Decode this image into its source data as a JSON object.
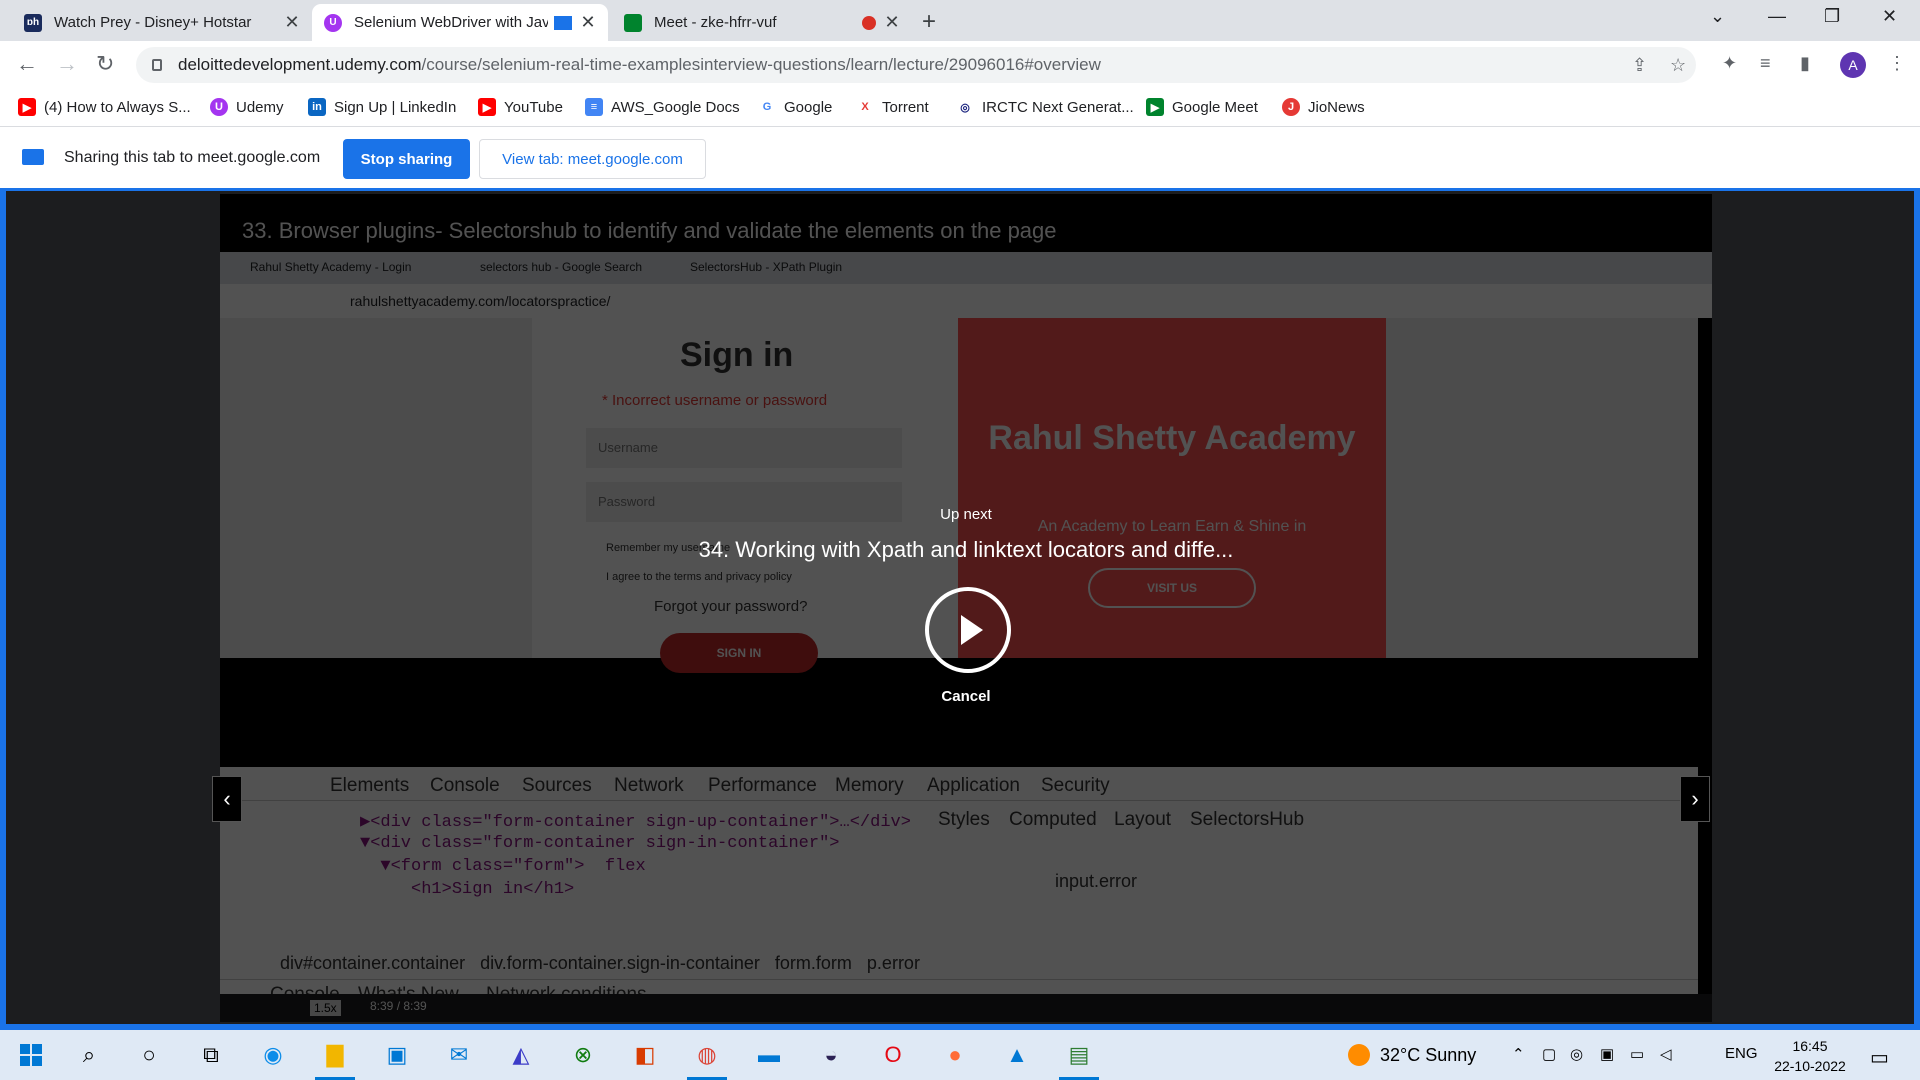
{
  "browser": {
    "tabs": [
      {
        "title": "Watch Prey - Disney+ Hotstar",
        "favicon": "hotstar-icon",
        "favicon_text": "ɒh",
        "color": "#1a2b5c"
      },
      {
        "title": "Selenium WebDriver with Jav",
        "favicon": "udemy-icon",
        "favicon_text": "U",
        "color": "#a435f0"
      },
      {
        "title": "Meet - zke-hfrr-vuf",
        "favicon": "google-meet-icon",
        "favicon_text": "",
        "color": "#00832d"
      }
    ],
    "url_domain": "deloittedevelopment.udemy.com",
    "url_path": "/course/selenium-real-time-examplesinterview-questions/learn/lecture/29096016#overview",
    "avatar_letter": "A"
  },
  "bookmarks": [
    {
      "label": "(4) How to Always S...",
      "icon": "youtube-icon",
      "color": "#ff0000",
      "glyph": "▶"
    },
    {
      "label": "Udemy",
      "icon": "udemy-icon",
      "color": "#a435f0",
      "glyph": "U"
    },
    {
      "label": "Sign Up | LinkedIn",
      "icon": "linkedin-icon",
      "color": "#0a66c2",
      "glyph": "in"
    },
    {
      "label": "YouTube",
      "icon": "youtube-icon",
      "color": "#ff0000",
      "glyph": "▶"
    },
    {
      "label": "AWS_Google Docs",
      "icon": "google-docs-icon",
      "color": "#4285f4",
      "glyph": "≡"
    },
    {
      "label": "Google",
      "icon": "google-icon",
      "color": "#ffffff",
      "glyph": "G"
    },
    {
      "label": "Torrent",
      "icon": "torrent-icon",
      "color": "#ffffff",
      "glyph": "X"
    },
    {
      "label": "IRCTC Next Generat...",
      "icon": "irctc-icon",
      "color": "#ffffff",
      "glyph": "◎"
    },
    {
      "label": "Google Meet",
      "icon": "google-meet-icon",
      "color": "#00832d",
      "glyph": "▶"
    },
    {
      "label": "JioNews",
      "icon": "jionews-icon",
      "color": "#e53935",
      "glyph": "J"
    }
  ],
  "sharing": {
    "text": "Sharing this tab to meet.google.com",
    "stop_label": "Stop sharing",
    "view_label": "View tab: meet.google.com"
  },
  "video": {
    "lecture_title": "33. Browser plugins- Selectorshub to identify and validate the elements on the page",
    "inner_tabs": [
      "Rahul Shetty Academy - Login",
      "selectors hub - Google Search",
      "SelectorsHub - XPath Plugin"
    ],
    "inner_url": "rahulshettyacademy.com/locatorspractice/",
    "signin_heading": "Sign in",
    "signin_error": "* Incorrect username or password",
    "username_placeholder": "Username",
    "password_placeholder": "Password",
    "remember_label": "Remember my username",
    "agree_label": "I agree to the terms and privacy policy",
    "forgot_label": "Forgot your password?",
    "signin_button": "SIGN IN",
    "brand_name": "Rahul Shetty Academy",
    "brand_tagline": "An Academy to Learn Earn & Shine in",
    "visit_button": "VISIT US",
    "devtools_tabs": [
      "Elements",
      "Console",
      "Sources",
      "Network",
      "Performance",
      "Memory",
      "Application",
      "Security"
    ],
    "side_tabs": [
      "Styles",
      "Computed",
      "Layout",
      "SelectorsHub"
    ],
    "code_lines": [
      "▶<div class=\"form-container sign-up-container\">…</div>",
      "▼<div class=\"form-container sign-in-container\">",
      "  ▼<form class=\"form\">  flex",
      "     <h1>Sign in</h1>"
    ],
    "breadcrumbs": "div#container.container   div.form-container.sign-in-container   form.form   p.error",
    "selector_input": "input.error",
    "drawer_tabs": [
      "Console",
      "What's New",
      "Network conditions"
    ],
    "speed": "1.5x",
    "time": "8:39 / 8:39"
  },
  "overlay": {
    "up_next_label": "Up next",
    "next_title": "34. Working with Xpath and linktext locators and diffe...",
    "cancel_label": "Cancel"
  },
  "taskbar": {
    "weather": "32°C  Sunny",
    "language": "ENG",
    "time": "16:45",
    "date": "22-10-2022"
  }
}
